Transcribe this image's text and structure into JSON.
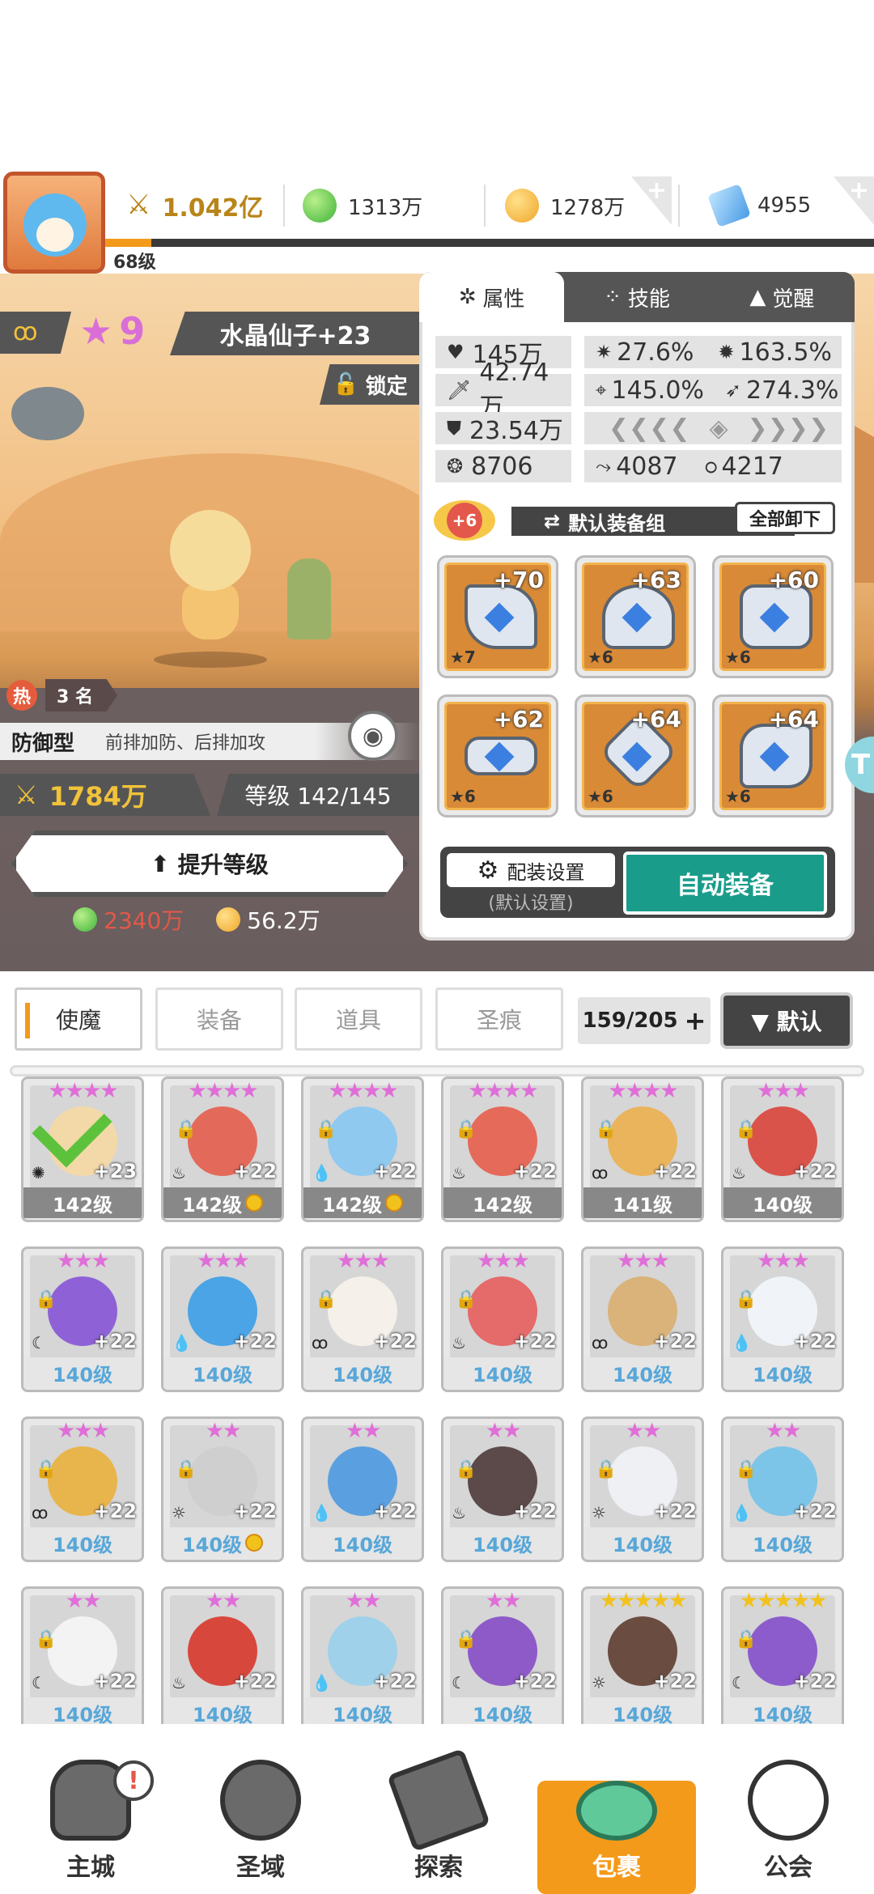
{
  "header": {
    "power": "1.042亿",
    "green_currency": "1313万",
    "gold_currency": "1278万",
    "gem_currency": "4955",
    "player_level": "68级",
    "xp_fraction": 0.06
  },
  "hero": {
    "star_count": "9",
    "name": "水晶仙子+23",
    "lock_label": "锁定",
    "hot_label": "热",
    "hot_rank": "3 名",
    "role_type": "防御型",
    "role_desc": "前排加防、后排加攻",
    "power": "1784万",
    "level_text": "等级 142/145",
    "upgrade_label": "提升等级",
    "cost_green": "2340万",
    "cost_gold": "56.2万"
  },
  "panel": {
    "tabs": [
      "属性",
      "技能",
      "觉醒"
    ],
    "stats": {
      "hp": "145万",
      "crit": "27.6%",
      "crit_dmg": "163.5%",
      "atk": "42.74万",
      "acc": "145.0%",
      "speed": "274.3%",
      "def": "23.54万",
      "s1": "8706",
      "s2": "4087",
      "s3": "4217"
    },
    "equip_plus": "+6",
    "equip_set": "默认装备组",
    "unequip_all": "全部卸下",
    "equipment": [
      {
        "lv": "+70",
        "star": "★7"
      },
      {
        "lv": "+63",
        "star": "★6"
      },
      {
        "lv": "+60",
        "star": "★6"
      },
      {
        "lv": "+62",
        "star": "★6"
      },
      {
        "lv": "+64",
        "star": "★6"
      },
      {
        "lv": "+64",
        "star": "★6"
      }
    ],
    "config_label": "配装设置",
    "config_sub": "(默认设置)",
    "auto_equip": "自动装备"
  },
  "inventory": {
    "tabs": [
      "使魔",
      "装备",
      "道具",
      "圣痕"
    ],
    "count": "159/205",
    "sort_label": "▼ 默认",
    "cards": [
      {
        "stars": "★★★★",
        "plus": "+23",
        "lv": "142级",
        "color": "#f4d9a8",
        "coin": false,
        "checked": true,
        "locked": false
      },
      {
        "stars": "★★★★",
        "plus": "+22",
        "lv": "142级",
        "color": "#e36a5a",
        "coin": true,
        "locked": true
      },
      {
        "stars": "★★★★",
        "plus": "+22",
        "lv": "142级",
        "color": "#8fc9ef",
        "coin": true,
        "locked": true
      },
      {
        "stars": "★★★★",
        "plus": "+22",
        "lv": "142级",
        "color": "#e66a5a",
        "coin": false,
        "locked": true
      },
      {
        "stars": "★★★★",
        "plus": "+22",
        "lv": "141级",
        "color": "#e9b45c",
        "coin": false,
        "locked": true
      },
      {
        "stars": "★★★",
        "plus": "+22",
        "lv": "140级",
        "color": "#d9534a",
        "coin": false,
        "locked": true
      },
      {
        "stars": "★★★",
        "plus": "+22",
        "lv": "140级",
        "color": "#8e62d6",
        "coin": false,
        "locked": true,
        "blue": true
      },
      {
        "stars": "★★★",
        "plus": "+22",
        "lv": "140级",
        "color": "#4aa4e6",
        "coin": false,
        "locked": false,
        "blue": true
      },
      {
        "stars": "★★★",
        "plus": "+22",
        "lv": "140级",
        "color": "#f5f0ea",
        "coin": false,
        "locked": true,
        "blue": true
      },
      {
        "stars": "★★★",
        "plus": "+22",
        "lv": "140级",
        "color": "#e56a6a",
        "coin": false,
        "locked": true,
        "blue": true
      },
      {
        "stars": "★★★",
        "plus": "+22",
        "lv": "140级",
        "color": "#d9b37a",
        "coin": false,
        "locked": false,
        "blue": true
      },
      {
        "stars": "★★★",
        "plus": "+22",
        "lv": "140级",
        "color": "#f0f4f8",
        "coin": false,
        "locked": true,
        "blue": true
      },
      {
        "stars": "★★★",
        "plus": "+22",
        "lv": "140级",
        "color": "#e8b54c",
        "coin": false,
        "locked": true,
        "blue": true
      },
      {
        "stars": "★★",
        "plus": "+22",
        "lv": "140级",
        "color": "#cfcfcf",
        "coin": true,
        "locked": true,
        "blue": true
      },
      {
        "stars": "★★",
        "plus": "+22",
        "lv": "140级",
        "color": "#5aa0e0",
        "coin": false,
        "locked": false,
        "blue": true
      },
      {
        "stars": "★★",
        "plus": "+22",
        "lv": "140级",
        "color": "#5c4a4a",
        "coin": false,
        "locked": true,
        "blue": true
      },
      {
        "stars": "★★",
        "plus": "+22",
        "lv": "140级",
        "color": "#eef0f4",
        "coin": false,
        "locked": true,
        "blue": true
      },
      {
        "stars": "★★",
        "plus": "+22",
        "lv": "140级",
        "color": "#7cc4e8",
        "coin": false,
        "locked": true,
        "blue": true
      },
      {
        "stars": "★★",
        "plus": "+22",
        "lv": "140级",
        "color": "#f3f3f3",
        "coin": false,
        "locked": true,
        "blue": true
      },
      {
        "stars": "★★",
        "plus": "+22",
        "lv": "140级",
        "color": "#d8473c",
        "coin": false,
        "locked": false,
        "blue": true
      },
      {
        "stars": "★★",
        "plus": "+22",
        "lv": "140级",
        "color": "#9fd1ea",
        "coin": false,
        "locked": false,
        "blue": true
      },
      {
        "stars": "★★",
        "plus": "+22",
        "lv": "140级",
        "color": "#8e5ac8",
        "coin": false,
        "locked": true,
        "blue": true
      },
      {
        "stars": "★★★★★",
        "plus": "+22",
        "lv": "140级",
        "color": "#6a4c40",
        "coin": false,
        "locked": false,
        "blue": true,
        "gold": true
      },
      {
        "stars": "★★★★★",
        "plus": "+22",
        "lv": "140级",
        "color": "#8c5ccc",
        "coin": false,
        "locked": true,
        "blue": true,
        "gold": true
      }
    ]
  },
  "nav": [
    "主城",
    "圣域",
    "探索",
    "包裹",
    "公会"
  ],
  "colors": {
    "accent": "#f39a1a",
    "teal": "#1a9c8b",
    "panel_dark": "#555555"
  }
}
